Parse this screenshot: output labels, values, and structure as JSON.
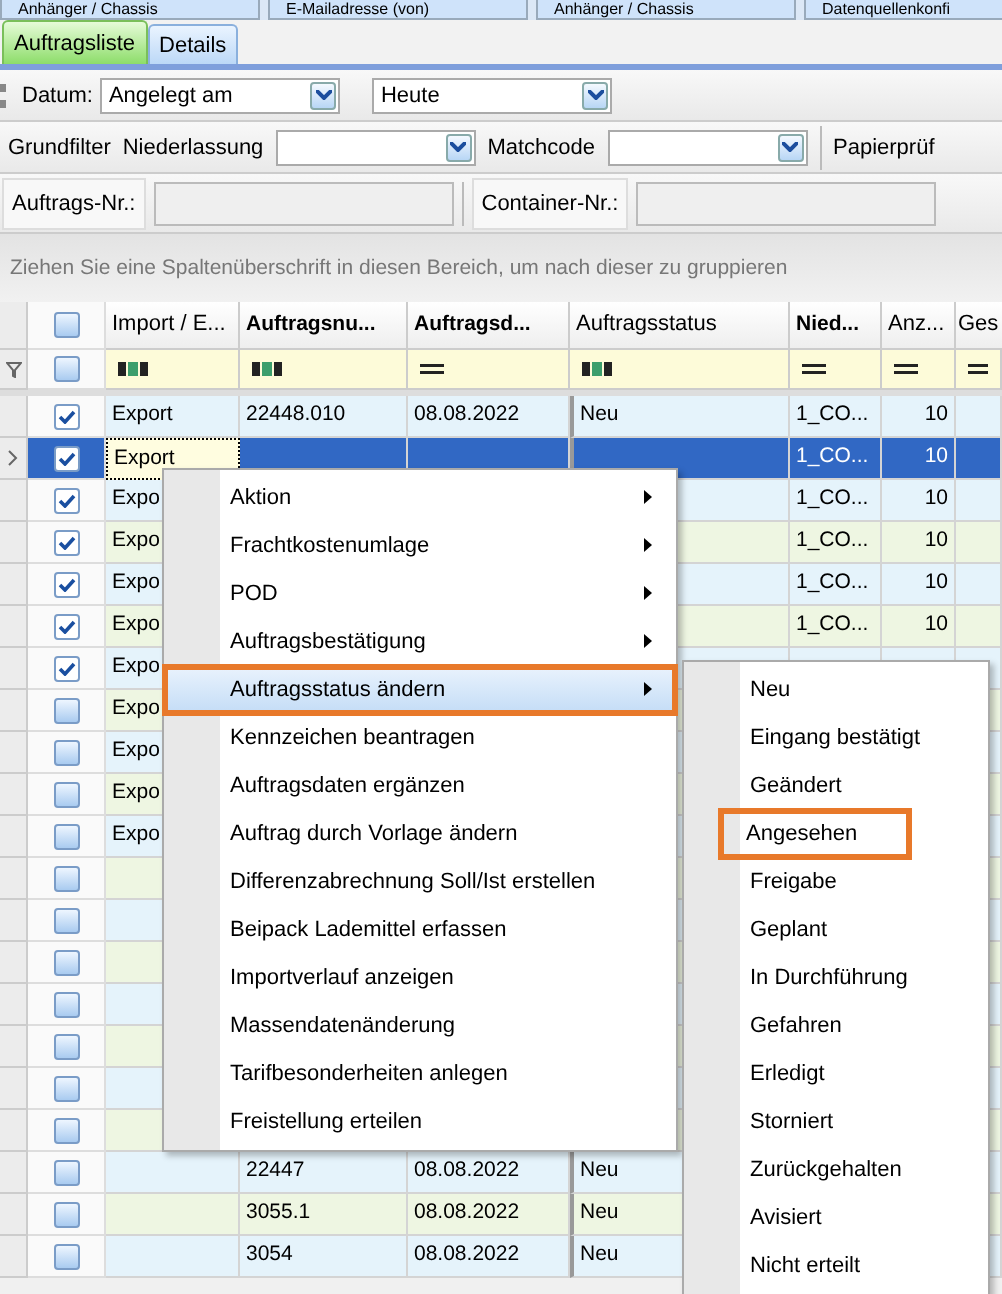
{
  "top_tabs": [
    "Anhänger / Chassis",
    "E-Mailadresse (von)",
    "Anhänger / Chassis",
    "Datenquellenkonfi"
  ],
  "tabs": [
    {
      "label": "Auftragsliste",
      "selected": true
    },
    {
      "label": "Details",
      "selected": false
    }
  ],
  "toolbar": {
    "datum_label": "Datum:",
    "datum_field": "Angelegt am",
    "zeitraum_field": "Heute",
    "grundfilter": "Grundfilter",
    "niederlassung_label": "Niederlassung",
    "matchcode_label": "Matchcode",
    "papier_label": "Papierprüf",
    "auftrag_label": "Auftrags-Nr.:",
    "container_label": "Container-Nr.:"
  },
  "group_panel": "Ziehen Sie eine Spaltenüberschrift in diesen Bereich, um nach dieser zu gruppieren",
  "table": {
    "header_checkbox": {
      "checked": false
    },
    "filter_checkbox": {
      "checked": false
    },
    "columns": [
      {
        "label": "Import / E...",
        "bold": false,
        "kind": "text"
      },
      {
        "label": "Auftragsnu...",
        "bold": true,
        "kind": "text"
      },
      {
        "label": "Auftragsd...",
        "bold": true,
        "kind": "equals"
      },
      {
        "label": "Auftragsstatus",
        "bold": false,
        "kind": "text"
      },
      {
        "label": "Nied...",
        "bold": true,
        "kind": "equals"
      },
      {
        "label": "Anz...",
        "bold": false,
        "kind": "equals"
      },
      {
        "label": "Ges",
        "bold": false,
        "kind": "equals"
      }
    ],
    "rows": [
      {
        "checked": true,
        "selected": false,
        "cells": [
          "Export",
          "22448.010",
          "08.08.2022",
          "Neu",
          "1_CO...",
          "10"
        ]
      },
      {
        "checked": true,
        "selected": true,
        "cells": [
          "Export",
          null,
          null,
          null,
          "1_CO...",
          "10"
        ]
      },
      {
        "checked": true,
        "selected": false,
        "cells": [
          "Expo",
          null,
          null,
          null,
          "1_CO...",
          "10"
        ]
      },
      {
        "checked": true,
        "selected": false,
        "cells": [
          "Expo",
          null,
          null,
          null,
          "1_CO...",
          "10"
        ]
      },
      {
        "checked": true,
        "selected": false,
        "cells": [
          "Expo",
          null,
          null,
          null,
          "1_CO...",
          "10"
        ]
      },
      {
        "checked": true,
        "selected": false,
        "cells": [
          "Expo",
          null,
          null,
          null,
          "1_CO...",
          "10"
        ]
      },
      {
        "checked": true,
        "selected": false,
        "cells": [
          "Expo"
        ]
      },
      {
        "checked": false,
        "selected": false,
        "cells": [
          "Expo"
        ]
      },
      {
        "checked": false,
        "selected": false,
        "cells": [
          "Expo"
        ]
      },
      {
        "checked": false,
        "selected": false,
        "cells": [
          "Expo"
        ]
      },
      {
        "checked": false,
        "selected": false,
        "cells": [
          "Expo"
        ]
      },
      {
        "checked": false,
        "selected": false,
        "cells": []
      },
      {
        "checked": false,
        "selected": false,
        "cells": []
      },
      {
        "checked": false,
        "selected": false,
        "cells": []
      },
      {
        "checked": false,
        "selected": false,
        "cells": []
      },
      {
        "checked": false,
        "selected": false,
        "cells": []
      },
      {
        "checked": false,
        "selected": false,
        "cells": []
      },
      {
        "checked": false,
        "selected": false,
        "cells": []
      },
      {
        "checked": false,
        "selected": false,
        "cells": [
          null,
          "22447",
          "08.08.2022",
          "Neu"
        ]
      },
      {
        "checked": false,
        "selected": false,
        "cells": [
          null,
          "3055.1",
          "08.08.2022",
          "Neu"
        ]
      },
      {
        "checked": false,
        "selected": false,
        "cells": [
          null,
          "3054",
          "08.08.2022",
          "Neu"
        ]
      }
    ]
  },
  "context_menu": {
    "items": [
      {
        "label": "Aktion",
        "submenu": true,
        "selected": false,
        "marked": false
      },
      {
        "label": "Frachtkostenumlage",
        "submenu": true,
        "selected": false,
        "marked": false
      },
      {
        "label": "POD",
        "submenu": true,
        "selected": false,
        "marked": false
      },
      {
        "label": "Auftragsbestätigung",
        "submenu": true,
        "selected": false,
        "marked": false
      },
      {
        "label": "Auftragsstatus ändern",
        "submenu": true,
        "selected": true,
        "marked": true
      },
      {
        "label": "Kennzeichen beantragen",
        "submenu": false,
        "selected": false,
        "marked": false
      },
      {
        "label": "Auftragsdaten ergänzen",
        "submenu": false,
        "selected": false,
        "marked": false
      },
      {
        "label": "Auftrag durch Vorlage ändern",
        "submenu": false,
        "selected": false,
        "marked": false
      },
      {
        "label": "Differenzabrechnung Soll/Ist erstellen",
        "submenu": false,
        "selected": false,
        "marked": false
      },
      {
        "label": "Beipack Lademittel erfassen",
        "submenu": false,
        "selected": false,
        "marked": false
      },
      {
        "label": "Importverlauf anzeigen",
        "submenu": false,
        "selected": false,
        "marked": false
      },
      {
        "label": "Massendatenänderung",
        "submenu": false,
        "selected": false,
        "marked": false
      },
      {
        "label": "Tarifbesonderheiten anlegen",
        "submenu": false,
        "selected": false,
        "marked": false
      },
      {
        "label": "Freistellung erteilen",
        "submenu": false,
        "selected": false,
        "marked": false
      }
    ],
    "submenu": [
      {
        "label": "Neu",
        "marked": false
      },
      {
        "label": "Eingang bestätigt",
        "marked": false
      },
      {
        "label": "Geändert",
        "marked": false
      },
      {
        "label": "Angesehen",
        "marked": true
      },
      {
        "label": "Freigabe",
        "marked": false
      },
      {
        "label": "Geplant",
        "marked": false
      },
      {
        "label": "In Durchführung",
        "marked": false
      },
      {
        "label": "Gefahren",
        "marked": false
      },
      {
        "label": "Erledigt",
        "marked": false
      },
      {
        "label": "Storniert",
        "marked": false
      },
      {
        "label": "Zurückgehalten",
        "marked": false
      },
      {
        "label": "Avisiert",
        "marked": false
      },
      {
        "label": "Nicht erteilt",
        "marked": false
      }
    ]
  }
}
